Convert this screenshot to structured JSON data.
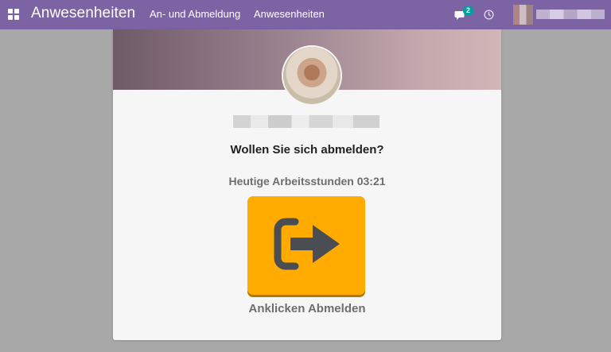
{
  "navbar": {
    "app_title": "Anwesenheiten",
    "menu": [
      {
        "label": "An- und Abmeldung"
      },
      {
        "label": "Anwesenheiten"
      }
    ],
    "chat_badge_count": "2",
    "accent_color": "#7c64a4",
    "badge_color": "#00a09d"
  },
  "kiosk": {
    "question": "Wollen Sie sich abmelden?",
    "hours_text": "Heutige Arbeitsstunden 03:21",
    "button_label": "Anklicken Abmelden",
    "button_color": "#ffab00",
    "button_icon": "sign-out-icon"
  }
}
